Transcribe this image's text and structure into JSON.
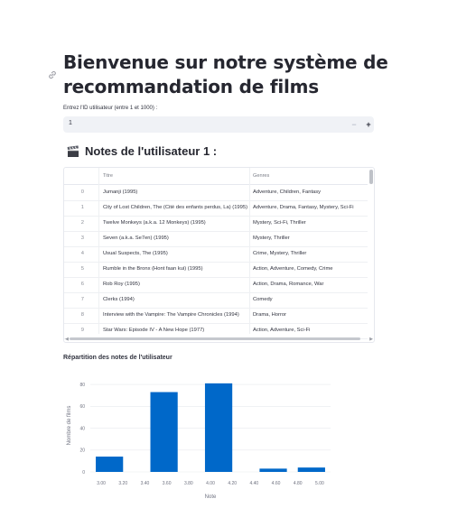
{
  "page": {
    "title": "Bienvenue sur notre système de recommandation de films",
    "input_label": "Entrez l'ID utilisateur (entre 1 et 1000) :",
    "input_value": "1",
    "minus_label": "−",
    "plus_label": "+",
    "ratings_heading": "Notes de l'utilisateur 1 :"
  },
  "table": {
    "columns": [
      "Titre",
      "Genres"
    ],
    "rows": [
      {
        "index": "0",
        "title": "Jumanji (1995)",
        "genres": "Adventure, Children, Fantasy"
      },
      {
        "index": "1",
        "title": "City of Lost Children, The (Cité des enfants perdus, La) (1995)",
        "genres": "Adventure, Drama, Fantasy, Mystery, Sci-Fi"
      },
      {
        "index": "2",
        "title": "Twelve Monkeys (a.k.a. 12 Monkeys) (1995)",
        "genres": "Mystery, Sci-Fi, Thriller"
      },
      {
        "index": "3",
        "title": "Seven (a.k.a. Se7en) (1995)",
        "genres": "Mystery, Thriller"
      },
      {
        "index": "4",
        "title": "Usual Suspects, The (1995)",
        "genres": "Crime, Mystery, Thriller"
      },
      {
        "index": "5",
        "title": "Rumble in the Bronx (Hont faan kui) (1995)",
        "genres": "Action, Adventure, Comedy, Crime"
      },
      {
        "index": "6",
        "title": "Rob Roy (1995)",
        "genres": "Action, Drama, Romance, War"
      },
      {
        "index": "7",
        "title": "Clerks (1994)",
        "genres": "Comedy"
      },
      {
        "index": "8",
        "title": "Interview with the Vampire: The Vampire Chronicles (1994)",
        "genres": "Drama, Horror"
      },
      {
        "index": "9",
        "title": "Star Wars: Episode IV - A New Hope (1977)",
        "genres": "Action, Adventure, Sci-Fi"
      }
    ]
  },
  "chart_heading": "Répartition des notes de l'utilisateur",
  "chart_data": {
    "type": "bar",
    "title": "",
    "xlabel": "Note",
    "ylabel": "Nombre de films",
    "xlim": [
      2.9,
      5.1
    ],
    "ylim": [
      0,
      85
    ],
    "x_ticks": [
      "3.00",
      "3.20",
      "3.40",
      "3.60",
      "3.80",
      "4.00",
      "4.20",
      "4.40",
      "4.60",
      "4.80",
      "5.00"
    ],
    "y_ticks": [
      "0",
      "20",
      "40",
      "60",
      "80"
    ],
    "bins": [
      {
        "start": 2.95,
        "end": 3.2,
        "value": 14
      },
      {
        "start": 3.45,
        "end": 3.7,
        "value": 73
      },
      {
        "start": 3.95,
        "end": 4.2,
        "value": 81
      },
      {
        "start": 4.45,
        "end": 4.7,
        "value": 3
      },
      {
        "start": 4.8,
        "end": 5.05,
        "value": 4
      }
    ],
    "bar_color": "#0068c9",
    "grid": true
  }
}
